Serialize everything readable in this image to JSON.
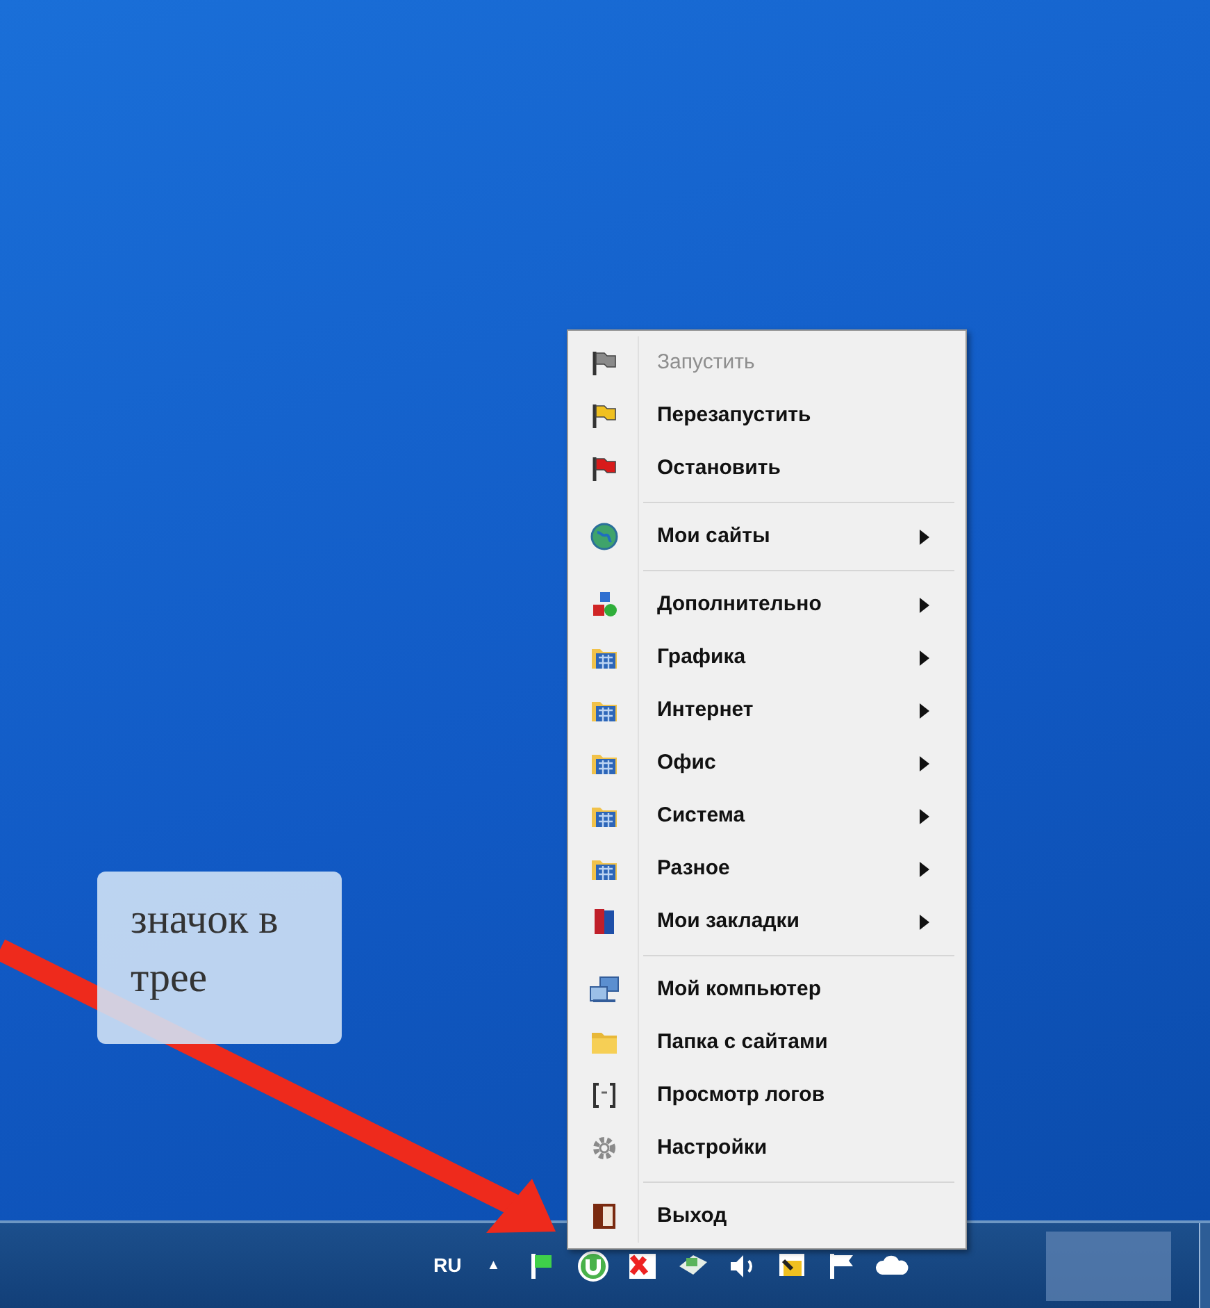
{
  "callout": {
    "text": "значок в трее"
  },
  "menu": {
    "sections": [
      {
        "items": [
          {
            "label": "Запустить",
            "disabled": true,
            "submenu": false
          },
          {
            "label": "Перезапустить",
            "disabled": false,
            "submenu": false
          },
          {
            "label": "Остановить",
            "disabled": false,
            "submenu": false
          }
        ]
      },
      {
        "items": [
          {
            "label": "Мои сайты",
            "disabled": false,
            "submenu": true
          }
        ]
      },
      {
        "items": [
          {
            "label": "Дополнительно",
            "disabled": false,
            "submenu": true
          },
          {
            "label": "Графика",
            "disabled": false,
            "submenu": true
          },
          {
            "label": "Интернет",
            "disabled": false,
            "submenu": true
          },
          {
            "label": "Офис",
            "disabled": false,
            "submenu": true
          },
          {
            "label": "Система",
            "disabled": false,
            "submenu": true
          },
          {
            "label": "Разное",
            "disabled": false,
            "submenu": true
          },
          {
            "label": "Мои закладки",
            "disabled": false,
            "submenu": true
          }
        ]
      },
      {
        "items": [
          {
            "label": "Мой компьютер",
            "disabled": false,
            "submenu": false
          },
          {
            "label": "Папка с сайтами",
            "disabled": false,
            "submenu": false
          },
          {
            "label": "Просмотр логов",
            "disabled": false,
            "submenu": false
          },
          {
            "label": "Настройки",
            "disabled": false,
            "submenu": false
          }
        ]
      },
      {
        "items": [
          {
            "label": "Выход",
            "disabled": false,
            "submenu": false
          }
        ]
      }
    ]
  },
  "taskbar": {
    "language": "RU",
    "tray_expand": "▲"
  }
}
